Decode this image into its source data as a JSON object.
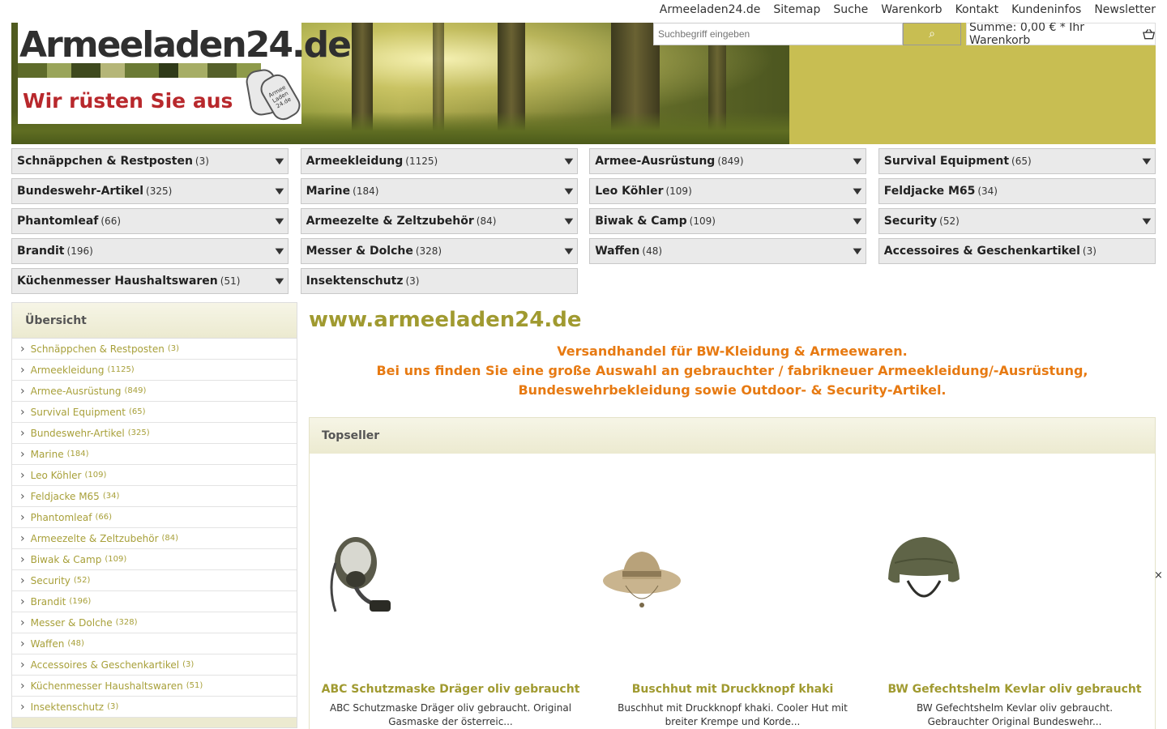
{
  "toplinks": [
    "Armeeladen24.de",
    "Sitemap",
    "Suche",
    "Warenkorb",
    "Kontakt",
    "Kundeninfos",
    "Newsletter"
  ],
  "logo": {
    "name": "Armeeladen24.de",
    "slogan": "Wir rüsten Sie aus",
    "tag_text": "Armee Laden 24.de"
  },
  "search": {
    "placeholder": "Suchbegriff eingeben",
    "button_icon": "search-icon"
  },
  "cart": {
    "label": "Summe: 0,00 € * Ihr Warenkorb",
    "icon": "basket-icon"
  },
  "categories": [
    {
      "label": "Schnäppchen & Restposten",
      "count": "(3)",
      "dropdown": true
    },
    {
      "label": "Armeekleidung",
      "count": "(1125)",
      "dropdown": true
    },
    {
      "label": "Armee-Ausrüstung",
      "count": "(849)",
      "dropdown": true
    },
    {
      "label": "Survival Equipment",
      "count": "(65)",
      "dropdown": true
    },
    {
      "label": "Bundeswehr-Artikel",
      "count": "(325)",
      "dropdown": true
    },
    {
      "label": "Marine",
      "count": "(184)",
      "dropdown": true
    },
    {
      "label": "Leo Köhler",
      "count": "(109)",
      "dropdown": true
    },
    {
      "label": "Feldjacke M65",
      "count": "(34)",
      "dropdown": false
    },
    {
      "label": "Phantomleaf",
      "count": "(66)",
      "dropdown": true
    },
    {
      "label": "Armeezelte & Zeltzubehör",
      "count": "(84)",
      "dropdown": true
    },
    {
      "label": "Biwak & Camp",
      "count": "(109)",
      "dropdown": true
    },
    {
      "label": "Security",
      "count": "(52)",
      "dropdown": true
    },
    {
      "label": "Brandit",
      "count": "(196)",
      "dropdown": true
    },
    {
      "label": "Messer & Dolche",
      "count": "(328)",
      "dropdown": true
    },
    {
      "label": "Waffen",
      "count": "(48)",
      "dropdown": true
    },
    {
      "label": "Accessoires & Geschenkartikel",
      "count": "(3)",
      "dropdown": false
    },
    {
      "label": "Küchenmesser Haushaltswaren",
      "count": "(51)",
      "dropdown": true
    },
    {
      "label": "Insektenschutz",
      "count": "(3)",
      "dropdown": false
    }
  ],
  "sidebar": {
    "title": "Übersicht",
    "items": [
      {
        "label": "Schnäppchen & Restposten",
        "count": "(3)"
      },
      {
        "label": "Armeekleidung",
        "count": "(1125)"
      },
      {
        "label": "Armee-Ausrüstung",
        "count": "(849)"
      },
      {
        "label": "Survival Equipment",
        "count": "(65)"
      },
      {
        "label": "Bundeswehr-Artikel",
        "count": "(325)"
      },
      {
        "label": "Marine",
        "count": "(184)"
      },
      {
        "label": "Leo Köhler",
        "count": "(109)"
      },
      {
        "label": "Feldjacke M65",
        "count": "(34)"
      },
      {
        "label": "Phantomleaf",
        "count": "(66)"
      },
      {
        "label": "Armeezelte & Zeltzubehör",
        "count": "(84)"
      },
      {
        "label": "Biwak & Camp",
        "count": "(109)"
      },
      {
        "label": "Security",
        "count": "(52)"
      },
      {
        "label": "Brandit",
        "count": "(196)"
      },
      {
        "label": "Messer & Dolche",
        "count": "(328)"
      },
      {
        "label": "Waffen",
        "count": "(48)"
      },
      {
        "label": "Accessoires & Geschenkartikel",
        "count": "(3)"
      },
      {
        "label": "Küchenmesser Haushaltswaren",
        "count": "(51)"
      },
      {
        "label": "Insektenschutz",
        "count": "(3)"
      }
    ]
  },
  "main": {
    "title": "www.armeeladen24.de",
    "intro": [
      "Versandhandel für BW-Kleidung & Armeewaren.",
      "Bei uns finden Sie eine große Auswahl an gebrauchter / fabrikneuer Armeekleidung/-Ausrüstung,",
      "Bundeswehrbekleidung sowie Outdoor- & Security-Artikel."
    ],
    "topseller_title": "Topseller",
    "products": [
      {
        "name": "ABC Schutzmaske Dräger oliv gebraucht",
        "desc": "ABC Schutzmaske Dräger oliv gebraucht. Original Gasmaske der österreic...",
        "image": "gas-mask-image"
      },
      {
        "name": "Buschhut mit Druckknopf khaki",
        "desc": "Buschhut mit Druckknopf khaki. Cooler Hut mit breiter Krempe und Korde...",
        "image": "bush-hat-image"
      },
      {
        "name": "BW Gefechtshelm Kevlar oliv gebraucht",
        "desc": "BW Gefechtshelm Kevlar oliv gebraucht. Gebrauchter Original Bundeswehr...",
        "image": "helmet-image"
      }
    ]
  },
  "close_label": "×"
}
